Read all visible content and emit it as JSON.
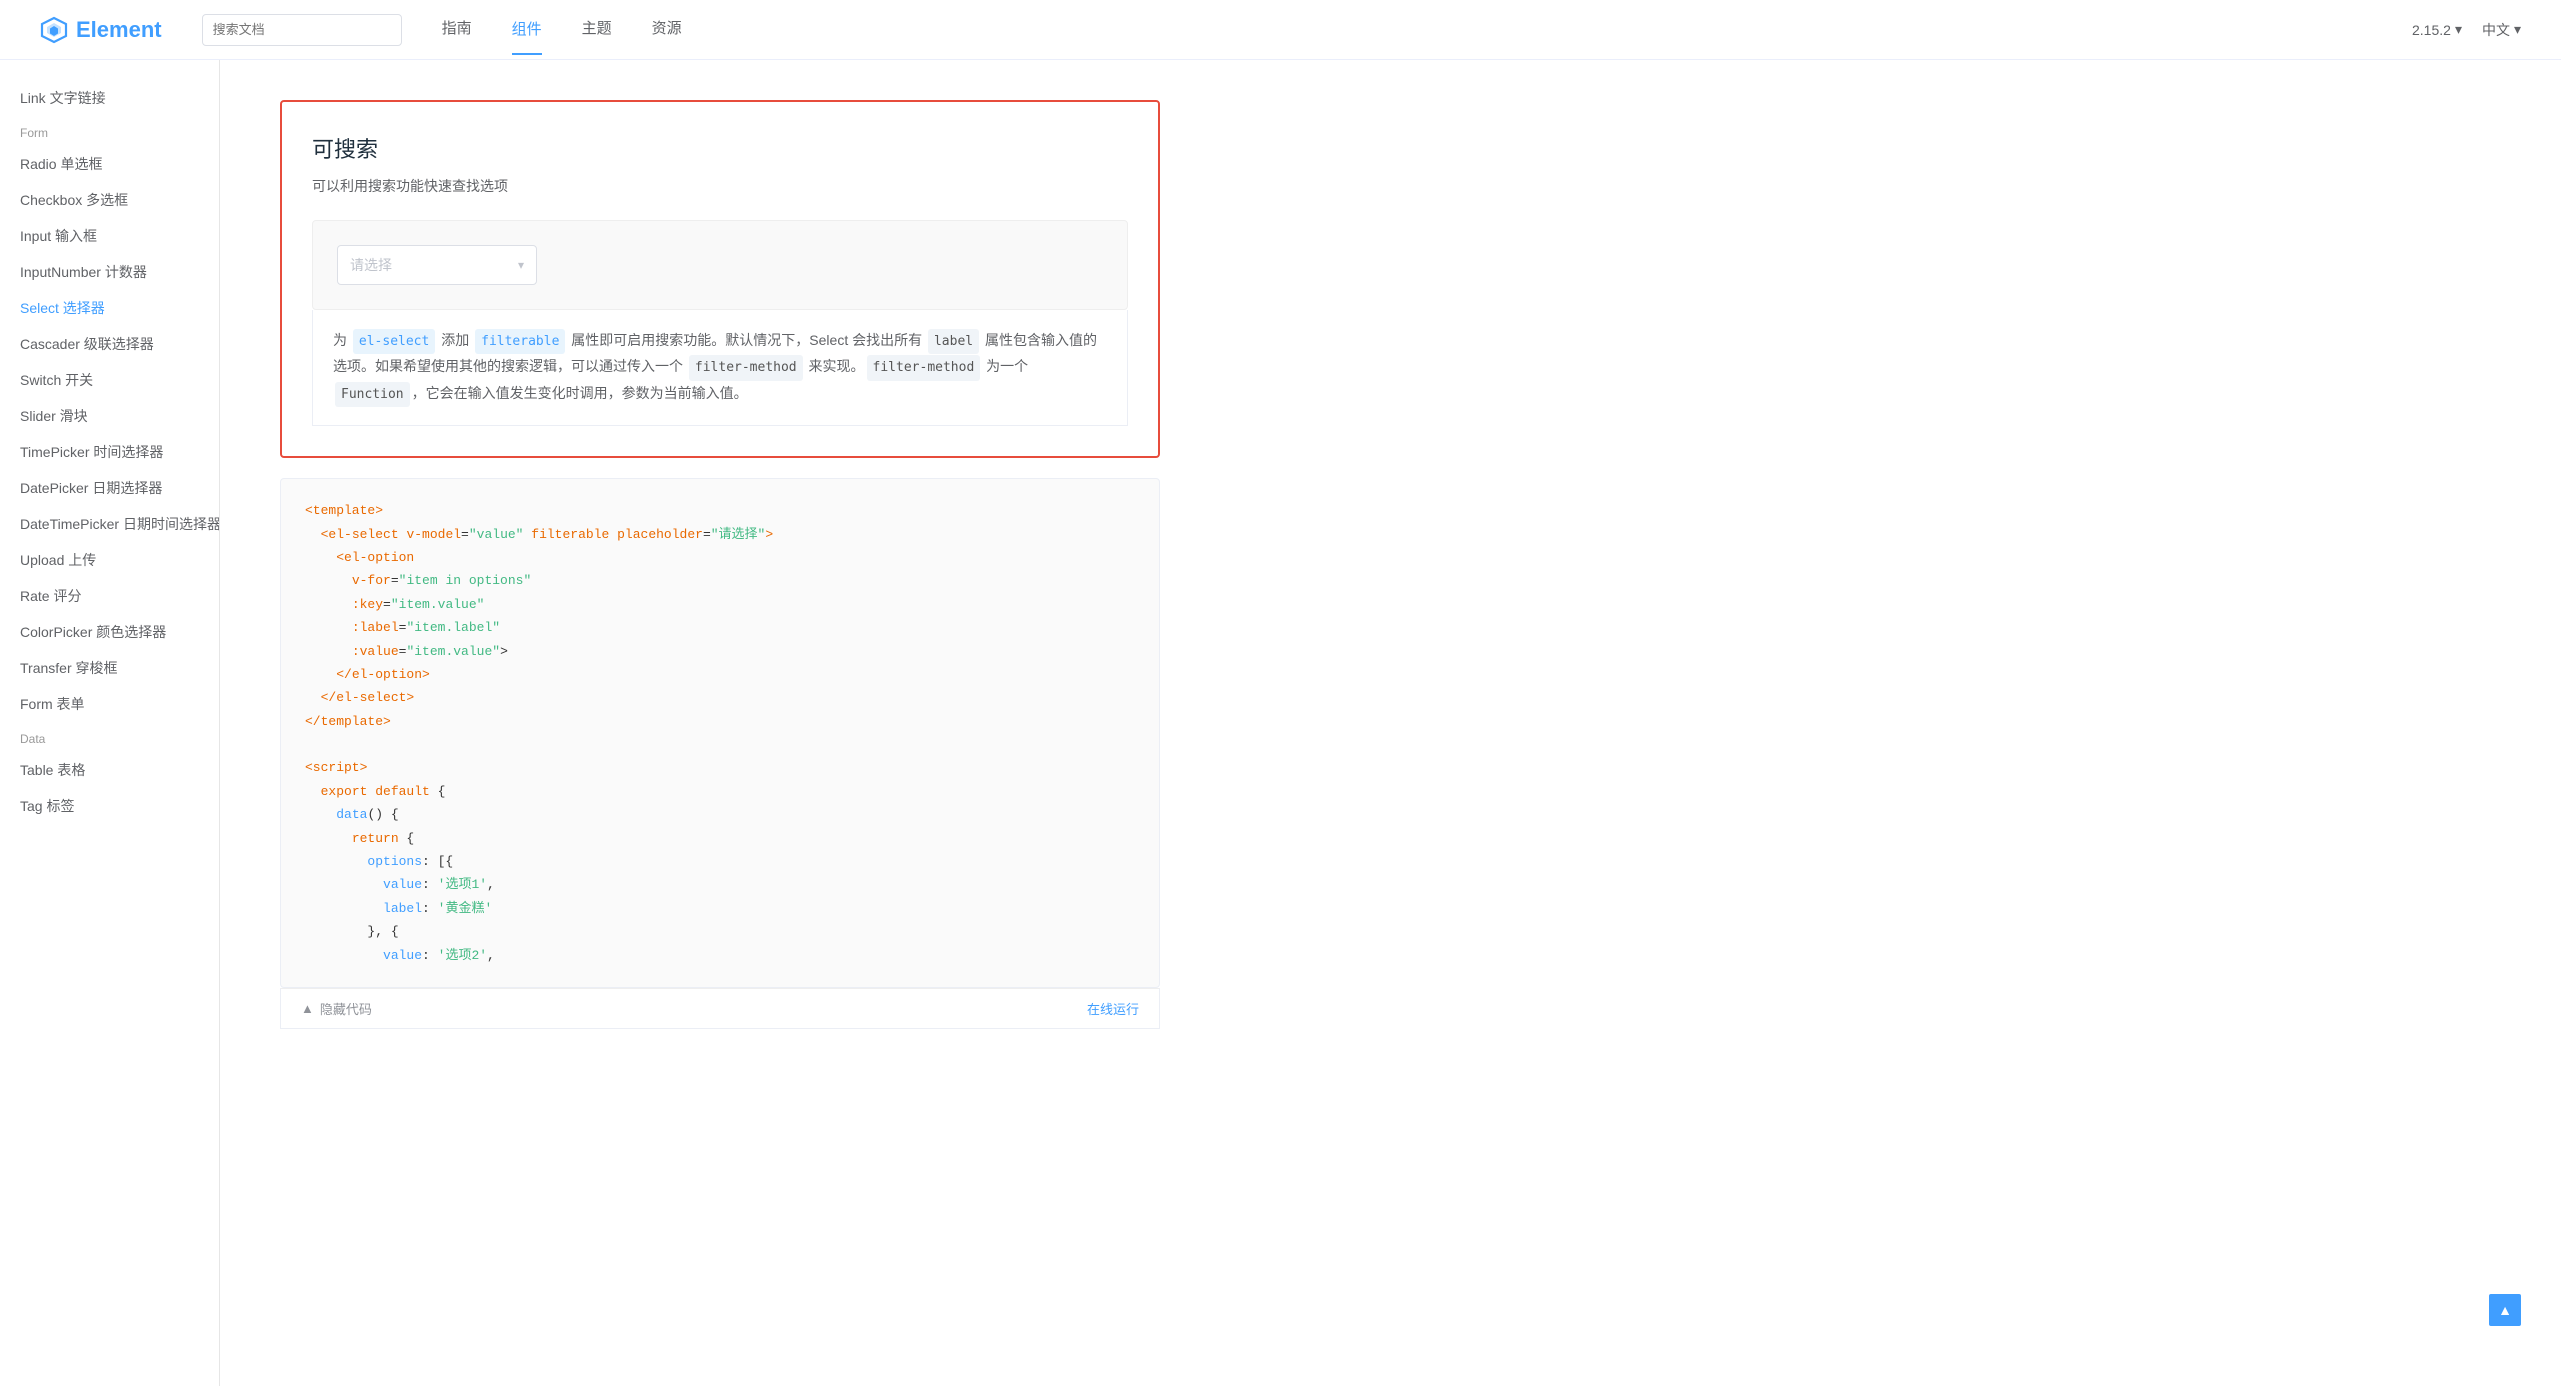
{
  "header": {
    "logo_text": "Element",
    "search_placeholder": "搜索文档",
    "nav": [
      {
        "label": "指南",
        "active": false
      },
      {
        "label": "组件",
        "active": true
      },
      {
        "label": "主题",
        "active": false
      },
      {
        "label": "资源",
        "active": false
      }
    ],
    "version": "2.15.2",
    "lang": "中文"
  },
  "sidebar": {
    "top_item": {
      "label": "Link 文字链接"
    },
    "sections": [
      {
        "title": "Form",
        "items": [
          {
            "label": "Radio 单选框",
            "active": false
          },
          {
            "label": "Checkbox 多选框",
            "active": false
          },
          {
            "label": "Input 输入框",
            "active": false
          },
          {
            "label": "InputNumber 计数器",
            "active": false
          },
          {
            "label": "Select 选择器",
            "active": true
          },
          {
            "label": "Cascader 级联选择器",
            "active": false
          },
          {
            "label": "Switch 开关",
            "active": false
          },
          {
            "label": "Slider 滑块",
            "active": false
          },
          {
            "label": "TimePicker 时间选择器",
            "active": false
          },
          {
            "label": "DatePicker 日期选择器",
            "active": false
          },
          {
            "label": "DateTimePicker 日期时间选择器",
            "active": false
          },
          {
            "label": "Upload 上传",
            "active": false
          },
          {
            "label": "Rate 评分",
            "active": false
          },
          {
            "label": "ColorPicker 颜色选择器",
            "active": false
          },
          {
            "label": "Transfer 穿梭框",
            "active": false
          },
          {
            "label": "Form 表单",
            "active": false
          }
        ]
      },
      {
        "title": "Data",
        "items": [
          {
            "label": "Table 表格",
            "active": false
          },
          {
            "label": "Tag 标签",
            "active": false
          }
        ]
      }
    ]
  },
  "main": {
    "section_title": "可搜索",
    "section_desc": "可以利用搜索功能快速查找选项",
    "select_placeholder": "请选择",
    "description_parts": [
      "为",
      "el-select",
      "添加",
      "filterable",
      "属性即可启用搜索功能。默认情况下，Select 会找出所有",
      "label",
      "属性包含输入值的选项。如果希望使用其他的搜索逻辑，可以通过传入一个",
      "filter-method",
      "来实现。",
      "filter-method",
      "为一个",
      "Function",
      "，它会在输入值发生变化时调用，参数为当前输入值。"
    ],
    "code_template": "<template>\n  <el-select v-model=\"value\" filterable placeholder=\"请选择\">\n    <el-option\n      v-for=\"item in options\"\n      :key=\"item.value\"\n      :label=\"item.label\"\n      :value=\"item.value\">\n    </el-option>\n  </el-select>\n</template>\n\n<script>\n  export default {\n    data() {\n      return {\n        options: [{\n          value: '选项1',\n          label: '黄金糕'\n        }, {\n          value: '选项2',",
    "code_footer_hide": "隐藏代码",
    "code_footer_run": "在线运行"
  }
}
